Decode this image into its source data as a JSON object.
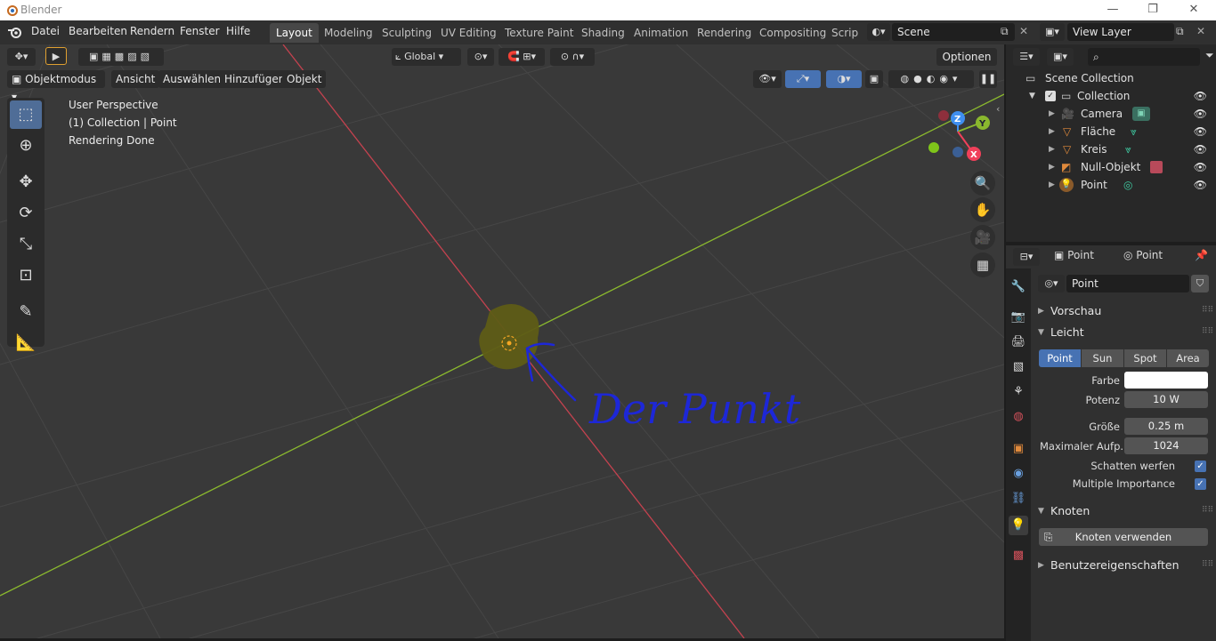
{
  "window": {
    "title": "Blender",
    "min": "—",
    "max": "❐",
    "close": "✕"
  },
  "menu": [
    "Datei",
    "Bearbeiten",
    "Rendern",
    "Fenster",
    "Hilfe"
  ],
  "workspaces": [
    "Layout",
    "Modeling",
    "Sculpting",
    "UV Editing",
    "Texture Paint",
    "Shading",
    "Animation",
    "Rendering",
    "Compositing",
    "Scrip"
  ],
  "scene": {
    "name": "Scene",
    "view_layer": "View Layer"
  },
  "viewport_header": {
    "transform_orientation": "Global",
    "options": "Optionen",
    "mode": "Objektmodus",
    "menus": [
      "Ansicht",
      "Auswählen",
      "Hinzufügen",
      "Objekt"
    ]
  },
  "viewport_overlay": {
    "perspective": "User Perspective",
    "collection": "(1) Collection | Point",
    "status": "Rendering Done"
  },
  "gizmo": {
    "z": "Z",
    "y": "Y",
    "x": "X"
  },
  "annotation": "Der Punkt",
  "outliner": {
    "root": "Scene Collection",
    "collection": "Collection",
    "items": [
      "Camera",
      "Fläche",
      "Kreis",
      "Null-Objekt",
      "Point"
    ]
  },
  "properties": {
    "object": "Point",
    "data": "Point",
    "datablock": "Point",
    "panels": {
      "preview": "Vorschau",
      "light": "Leicht",
      "nodes": "Knoten",
      "custom": "Benutzereigenschaften"
    },
    "light_types": [
      "Point",
      "Sun",
      "Spot",
      "Area"
    ],
    "active_light_type": "Point",
    "fields": {
      "color_label": "Farbe",
      "power_label": "Potenz",
      "power": "10 W",
      "size_label": "Größe",
      "size": "0.25 m",
      "max_label": "Maximaler Aufp..",
      "max": "1024",
      "shadow_label": "Schatten werfen",
      "mis_label": "Multiple Importance"
    },
    "use_nodes": "Knoten verwenden"
  },
  "colors": {
    "accent": "#4772b3",
    "x_axis": "#c4424f",
    "y_axis": "#8ab82e",
    "annotation": "#1d27d8"
  }
}
